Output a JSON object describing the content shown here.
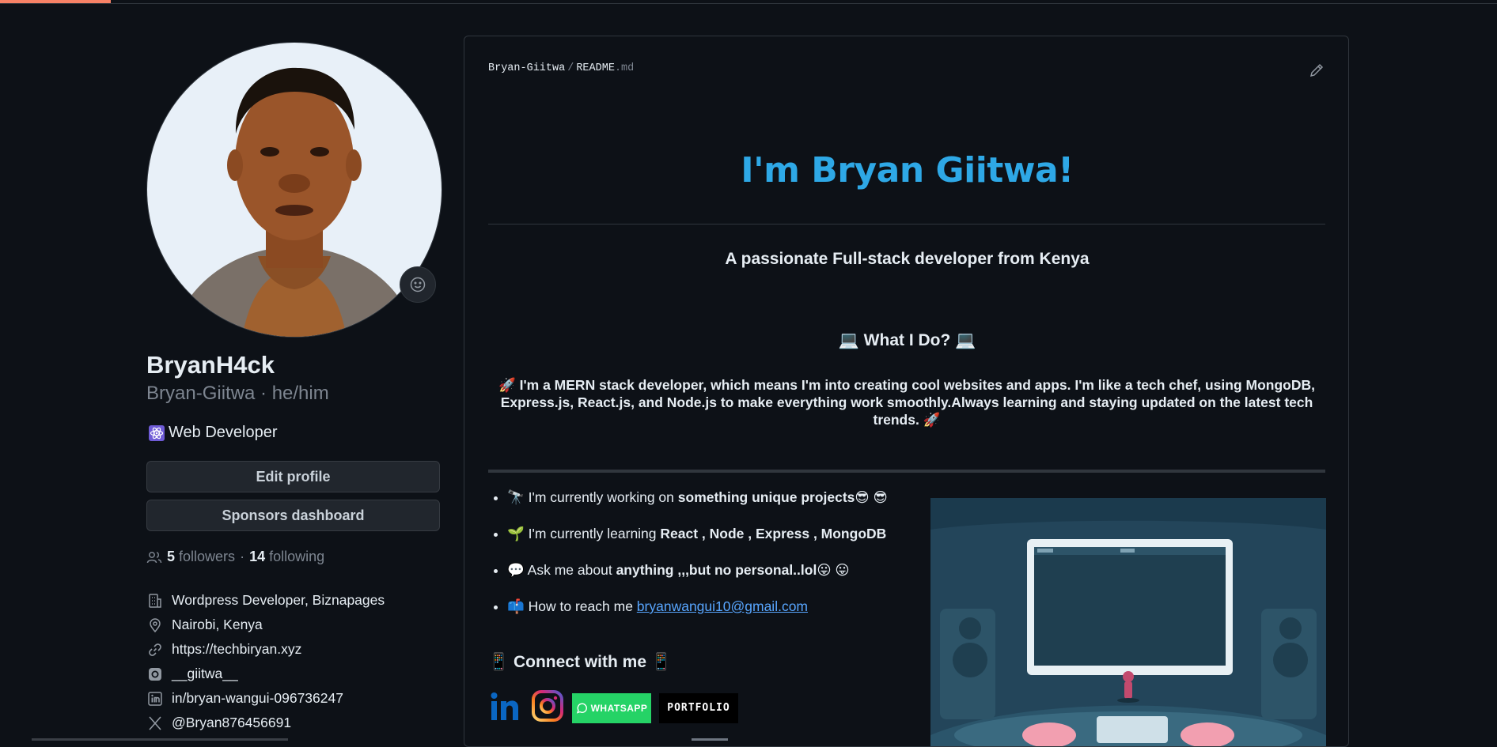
{
  "profile": {
    "name": "BryanH4ck",
    "login": "Bryan-Giitwa · he/him",
    "bio": "Web Developer",
    "edit_profile": "Edit profile",
    "sponsors_dashboard": "Sponsors dashboard",
    "followers_count": "5",
    "followers_label": "followers",
    "dot": "·",
    "following_count": "14",
    "following_label": "following",
    "details": [
      {
        "icon": "building-icon",
        "text": "Wordpress Developer, Biznapages"
      },
      {
        "icon": "location-icon",
        "text": "Nairobi, Kenya"
      },
      {
        "icon": "link-icon",
        "text": "https://techbiryan.xyz"
      },
      {
        "icon": "instagram-icon",
        "text": "__giitwa__"
      },
      {
        "icon": "linkedin-icon",
        "text": "in/bryan-wangui-096736247"
      },
      {
        "icon": "x-icon",
        "text": "@Bryan876456691"
      }
    ]
  },
  "readme": {
    "breadcrumb_owner": "Bryan-Giitwa",
    "breadcrumb_sep": "/",
    "breadcrumb_file": "README",
    "breadcrumb_ext": ".md",
    "heading": "I'm Bryan Giitwa!",
    "tagline": "A passionate Full-stack developer from Kenya",
    "what_heading": "💻 What I Do? 💻",
    "paragraph": "🚀 I'm a MERN stack developer, which means I'm into creating cool websites and apps. I'm like a tech chef, using MongoDB, Express.js, React.js, and Node.js to make everything work smoothly.Always learning and staying updated on the latest tech trends. 🚀",
    "bullets": [
      {
        "prefix": "🔭 I'm currently working on ",
        "bold": "something unique projects😎 😎"
      },
      {
        "prefix": "🌱 I'm currently learning ",
        "bold": "React , Node , Express , MongoDB"
      },
      {
        "prefix": "💬 Ask me about ",
        "bold": "anything ,,,but no personal..lol😛 😛"
      },
      {
        "prefix": "📫 How to reach me ",
        "link": "bryanwangui10@gmail.com"
      }
    ],
    "connect_heading": "📱 Connect with me 📱",
    "whatsapp_label": "WHATSAPP",
    "portfolio_label": "PORTFOLIO"
  },
  "colors": {
    "accent": "#2ea8e6",
    "link": "#58a6ff",
    "tab_underline": "#f78166"
  }
}
